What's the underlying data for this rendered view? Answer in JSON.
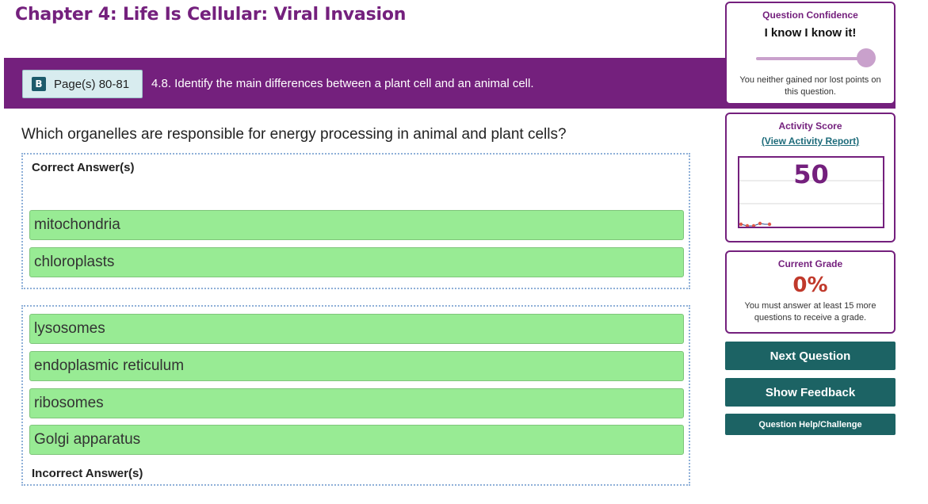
{
  "chapter_title": "Chapter 4: Life Is Cellular: Viral Invasion",
  "banner": {
    "page_ref": "Page(s) 80-81",
    "book_icon": "book-icon",
    "objective": "4.8. Identify the main differences between a plant cell and an animal cell."
  },
  "question": "Which organelles are responsible for energy processing in animal and plant cells?",
  "correct_box": {
    "label": "Correct Answer(s)",
    "answers": [
      "mitochondria",
      "chloroplasts"
    ]
  },
  "incorrect_box": {
    "label": "Incorrect Answer(s)",
    "answers": [
      "lysosomes",
      "endoplasmic reticulum",
      "ribosomes",
      "Golgi apparatus"
    ]
  },
  "confidence": {
    "title": "Question Confidence",
    "level": "I know I know it!",
    "slider_value": 1.0,
    "note": "You neither gained nor lost points on this question."
  },
  "activity": {
    "title": "Activity Score",
    "report_link": "(View Activity Report)",
    "score": "50"
  },
  "grade": {
    "title": "Current Grade",
    "value": "0%",
    "note": "You must answer at least 15 more questions to receive a grade."
  },
  "buttons": {
    "next": "Next Question",
    "feedback": "Show Feedback",
    "help": "Question Help/Challenge"
  },
  "colors": {
    "brand_purple": "#74207d",
    "answer_green": "#98eb94",
    "button_teal": "#1c6364",
    "grade_red": "#c0392b"
  }
}
